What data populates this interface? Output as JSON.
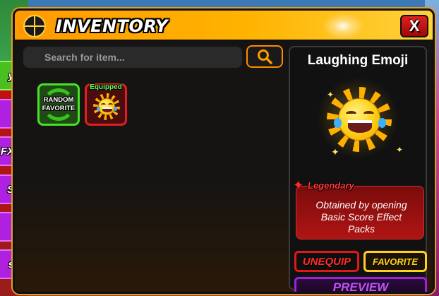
{
  "window": {
    "title": "INVENTORY",
    "close_label": "X"
  },
  "side_tabs": [
    {
      "label": "y",
      "color": "#4ac020"
    },
    {
      "label": "",
      "color": "#b020e0"
    },
    {
      "label": "FX",
      "color": "#b020e0"
    },
    {
      "label": "S",
      "color": "#b020e0"
    },
    {
      "label": "",
      "color": "#b020e0"
    },
    {
      "label": "s",
      "color": "#b020e0"
    },
    {
      "label": "",
      "color": "#b020e0"
    }
  ],
  "search": {
    "placeholder": "Search for item..."
  },
  "items": [
    {
      "label": "RANDOM\nFAVORITE",
      "border_color": "#4ae02a"
    },
    {
      "tag": "Equipped",
      "icon": "laughing-sun-emoji-icon",
      "border_color": "#e02020"
    }
  ],
  "detail": {
    "name": "Laughing Emoji",
    "rarity": "Legendary",
    "rarity_color": "#ff3a3a",
    "description": "Obtained by opening Basic Score Effect Packs",
    "unequip_label": "UNEQUIP",
    "favorite_label": "FAVORITE",
    "preview_label": "PREVIEW"
  },
  "colors": {
    "accent_orange": "#ff9a00",
    "legendary_red": "#e01818",
    "favorite_gold": "#ffd020",
    "preview_purple": "#a020e0"
  }
}
